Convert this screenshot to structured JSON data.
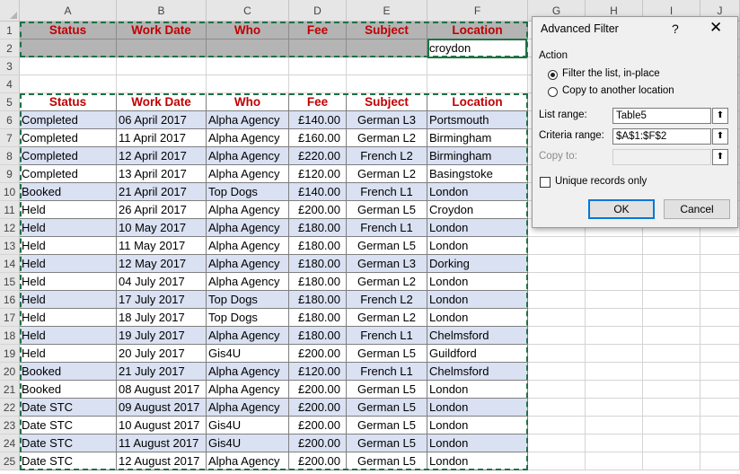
{
  "columns": [
    "A",
    "B",
    "C",
    "D",
    "E",
    "F",
    "G",
    "H",
    "I",
    "J"
  ],
  "row_numbers": [
    "1",
    "2",
    "3",
    "4",
    "5",
    "6",
    "7",
    "8",
    "9",
    "10",
    "11",
    "12",
    "13",
    "14",
    "15",
    "16",
    "17",
    "18",
    "19",
    "20",
    "21",
    "22",
    "23",
    "24",
    "25"
  ],
  "headers": [
    "Status",
    "Work Date",
    "Who",
    "Fee",
    "Subject",
    "Location"
  ],
  "criteria_row": [
    "",
    "",
    "",
    "",
    "",
    "croydon"
  ],
  "table_rows": [
    [
      "Completed",
      "06 April 2017",
      "Alpha Agency",
      "£140.00",
      "German L3",
      "Portsmouth"
    ],
    [
      "Completed",
      "11 April 2017",
      "Alpha Agency",
      "£160.00",
      "German L2",
      "Birmingham"
    ],
    [
      "Completed",
      "12 April 2017",
      "Alpha Agency",
      "£220.00",
      "French L2",
      "Birmingham"
    ],
    [
      "Completed",
      "13 April 2017",
      "Alpha Agency",
      "£120.00",
      "German L2",
      "Basingstoke"
    ],
    [
      "Booked",
      "21 April 2017",
      "Top Dogs",
      "£140.00",
      "French L1",
      "London"
    ],
    [
      "Held",
      "26 April 2017",
      "Alpha Agency",
      "£200.00",
      "German L5",
      "Croydon"
    ],
    [
      "Held",
      "10 May 2017",
      "Alpha Agency",
      "£180.00",
      "French L1",
      "London"
    ],
    [
      "Held",
      "11 May 2017",
      "Alpha Agency",
      "£180.00",
      "German L5",
      "London"
    ],
    [
      "Held",
      "12 May 2017",
      "Alpha Agency",
      "£180.00",
      "German L3",
      "Dorking"
    ],
    [
      "Held",
      "04 July 2017",
      "Alpha Agency",
      "£180.00",
      "German L2",
      "London"
    ],
    [
      "Held",
      "17 July 2017",
      "Top Dogs",
      "£180.00",
      "French L2",
      "London"
    ],
    [
      "Held",
      "18 July 2017",
      "Top Dogs",
      "£180.00",
      "German L2",
      "London"
    ],
    [
      "Held",
      "19 July 2017",
      "Alpha Agency",
      "£180.00",
      "French L1",
      "Chelmsford"
    ],
    [
      "Held",
      "20 July 2017",
      "Gis4U",
      "£200.00",
      "German L5",
      "Guildford"
    ],
    [
      "Booked",
      "21 July 2017",
      "Alpha Agency",
      "£120.00",
      "French L1",
      "Chelmsford"
    ],
    [
      "Booked",
      "08 August 2017",
      "Alpha Agency",
      "£200.00",
      "German L5",
      "London"
    ],
    [
      "Date STC",
      "09 August 2017",
      "Alpha Agency",
      "£200.00",
      "German L5",
      "London"
    ],
    [
      "Date STC",
      "10 August 2017",
      "Gis4U",
      "£200.00",
      "German L5",
      "London"
    ],
    [
      "Date STC",
      "11 August 2017",
      "Gis4U",
      "£200.00",
      "German L5",
      "London"
    ],
    [
      "Date STC",
      "12 August 2017",
      "Alpha Agency",
      "£200.00",
      "German L5",
      "London"
    ]
  ],
  "colors": {
    "header_text": "#c00000",
    "criteria_fill": "#b4b4b4",
    "band_fill": "#d9e1f2",
    "marquee": "#1e7145",
    "ok_border": "#0078d7"
  },
  "dialog": {
    "title": "Advanced Filter",
    "help": "?",
    "close": "✕",
    "action_label": "Action",
    "filter_in_place": "Filter the list, in-place",
    "copy_to_location": "Copy to another location",
    "selected_action": "filter_in_place",
    "list_range_label": "List range:",
    "list_range_value": "Table5",
    "criteria_range_label": "Criteria range:",
    "criteria_range_value": "$A$1:$F$2",
    "copy_to_label": "Copy to:",
    "copy_to_value": "",
    "unique_label": "Unique records only",
    "unique_checked": false,
    "ok": "OK",
    "cancel": "Cancel"
  }
}
